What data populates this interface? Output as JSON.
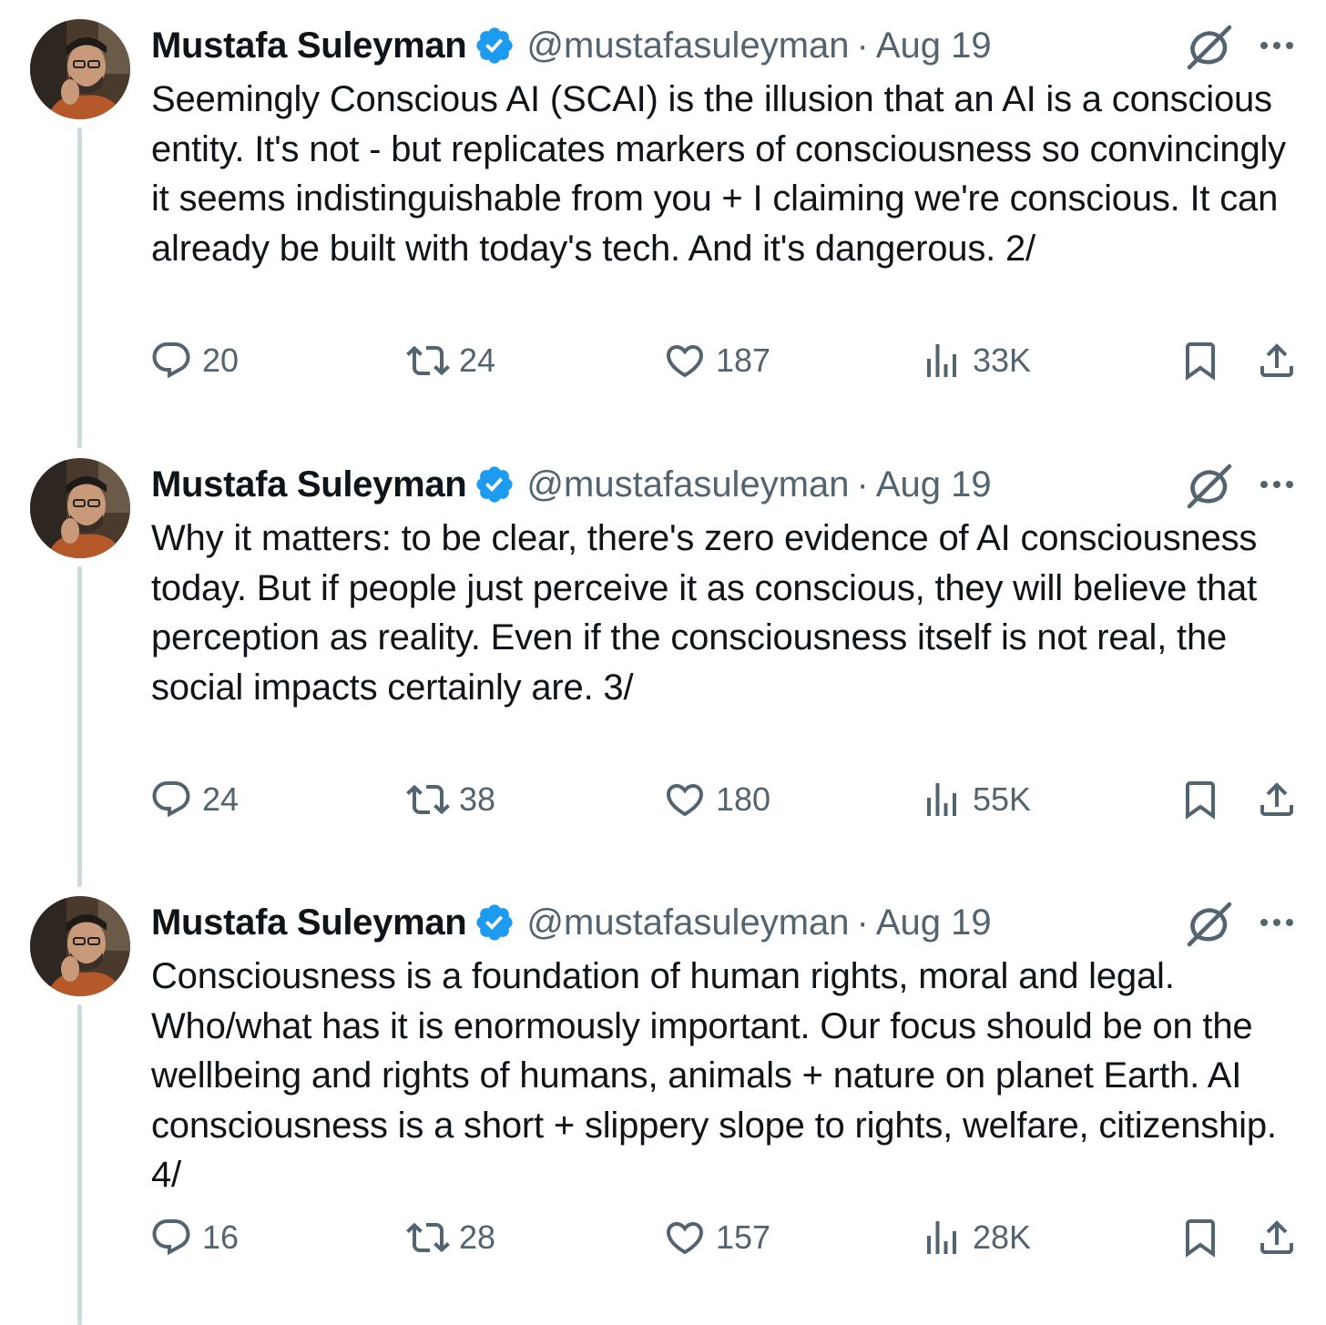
{
  "author": {
    "name": "Mustafa Suleyman",
    "handle": "@mustafasuleyman",
    "verified_color": "#1d9bf0"
  },
  "separator": "·",
  "icons": {
    "reply": "reply-icon",
    "retweet": "retweet-icon",
    "like": "heart-icon",
    "views": "views-icon",
    "bookmark": "bookmark-icon",
    "share": "share-icon",
    "grok": "grok-icon",
    "more": "more-icon"
  },
  "tweets": [
    {
      "date": "Aug 19",
      "text": "Seemingly Conscious AI (SCAI) is the illusion that an AI is a conscious entity. It's not - but replicates markers of consciousness so convincingly it seems indistinguishable from you + I claiming we're conscious. It can already be built with today's tech. And it's dangerous. 2/",
      "replies": "20",
      "retweets": "24",
      "likes": "187",
      "views": "33K"
    },
    {
      "date": "Aug 19",
      "text": "Why it matters: to be clear, there's zero evidence of AI consciousness today. But if people just perceive it as conscious, they will believe that perception as reality. Even if the consciousness itself is not real, the social impacts certainly are. 3/",
      "replies": "24",
      "retweets": "38",
      "likes": "180",
      "views": "55K"
    },
    {
      "date": "Aug 19",
      "text": "Consciousness is a foundation of human rights, moral and legal. Who/what has it is enormously important. Our focus should be on the wellbeing and rights of humans, animals + nature on planet Earth. AI consciousness is a short + slippery slope to rights, welfare, citizenship. 4/",
      "replies": "16",
      "retweets": "28",
      "likes": "157",
      "views": "28K"
    }
  ]
}
